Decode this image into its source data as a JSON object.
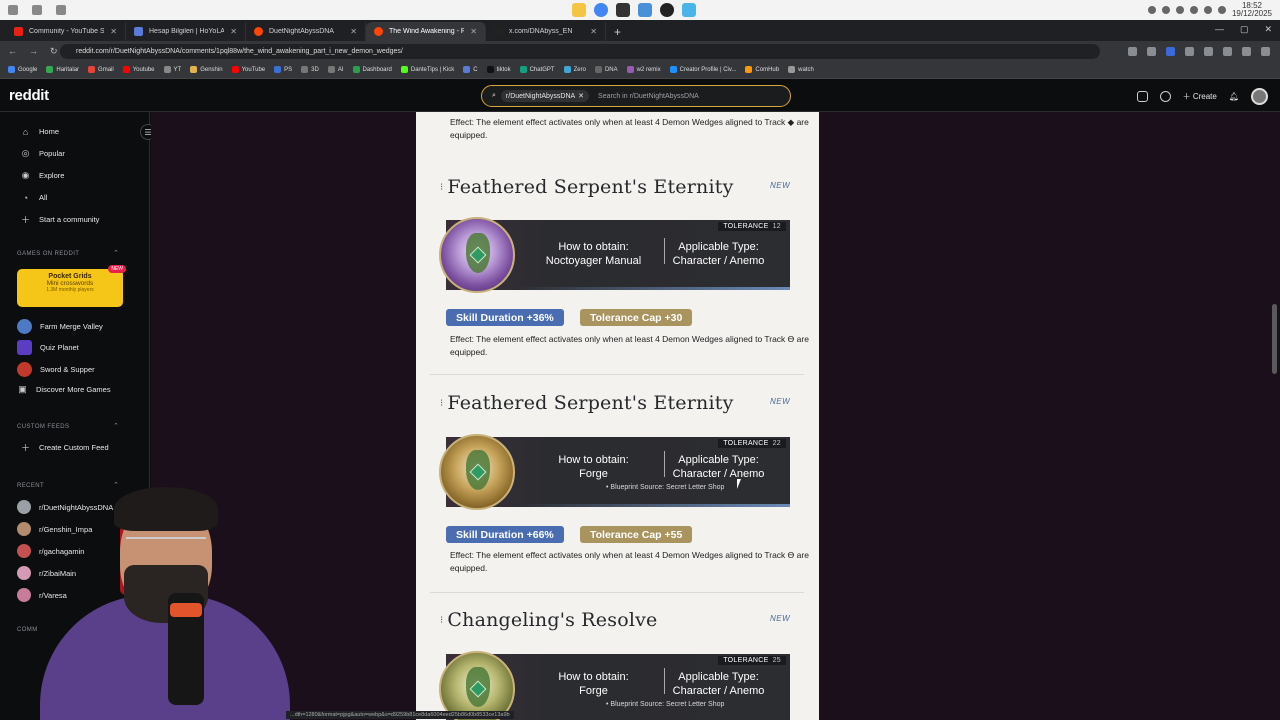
{
  "browser": {
    "tabs": [
      {
        "label": "Community - YouTube Studio",
        "color": "#e62117"
      },
      {
        "label": "Hesap Bilgileri | HoYoLAB",
        "color": "#5a7bd8"
      },
      {
        "label": "DuetNightAbyssDNA",
        "color": "#ff4500"
      },
      {
        "label": "The Wind Awakening - Part I | N",
        "color": "#ff4500"
      },
      {
        "label": "x.com/DNAbyss_EN",
        "color": "#222222"
      }
    ],
    "url": "reddit.com/r/DuetNightAbyssDNA/comments/1pql88w/the_wind_awakening_part_i_new_demon_wedges/",
    "bookmarks": [
      "Google",
      "Haritalar",
      "Gmail",
      "Youtube",
      "YT",
      "Genshin",
      "YouTube",
      "PS",
      "3D",
      "AI",
      "Dashboard",
      "DanteTips | Kick",
      "C",
      "tiktok",
      "ChatGPT",
      "Zero",
      "DNA",
      "w2 remix",
      "Creator Profile | Civ...",
      "ComHub",
      "watch"
    ],
    "clock_time": "18:52",
    "clock_date": "19/12/2025"
  },
  "reddit": {
    "logo": "reddit",
    "search_chip": "r/DuetNightAbyssDNA",
    "search_placeholder": "Search in r/DuetNightAbyssDNA",
    "create_label": "Create"
  },
  "sidebar": {
    "nav": [
      {
        "label": "Home",
        "icon": "home-icon"
      },
      {
        "label": "Popular",
        "icon": "popular-icon"
      },
      {
        "label": "Explore",
        "icon": "explore-icon"
      },
      {
        "label": "All",
        "icon": "all-icon"
      },
      {
        "label": "Start a community",
        "icon": "plus-icon"
      }
    ],
    "games_heading": "GAMES ON REDDIT",
    "promo": {
      "title": "Pocket Grids",
      "subtitle": "Mini crosswords",
      "players": "1.3M monthly players",
      "badge": "NEW"
    },
    "games": [
      "Farm Merge Valley",
      "Quiz Planet",
      "Sword & Supper",
      "Discover More Games"
    ],
    "custom_heading": "CUSTOM FEEDS",
    "create_feed": "Create Custom Feed",
    "recent_heading": "RECENT",
    "recent": [
      "r/DuetNightAbyssDNA",
      "r/Genshin_Impa",
      "r/gachagamin",
      "r/ZibaiMain",
      "r/Varesa"
    ],
    "communities_heading": "COMM"
  },
  "content": {
    "top_effect": "Effect: The element effect activates only when at least 4 Demon Wedges aligned to Track ◆ are equipped.",
    "items": [
      {
        "title": "Feathered Serpent's Eternity",
        "new": "NEW",
        "tolerance_label": "TOLERANCE",
        "tolerance_value": "12",
        "obtain_label": "How to obtain:",
        "obtain_value": "Noctoyager Manual",
        "type_label": "Applicable Type:",
        "type_value": "Character / Anemo",
        "blueprint": "",
        "stat1": "Skill Duration +36%",
        "stat2": "Tolerance Cap +30",
        "effect": "Effect: The element effect activates only when at least 4 Demon Wedges aligned to Track ϴ are equipped."
      },
      {
        "title": "Feathered Serpent's Eternity",
        "new": "NEW",
        "tolerance_label": "TOLERANCE",
        "tolerance_value": "22",
        "obtain_label": "How to obtain:",
        "obtain_value": "Forge",
        "type_label": "Applicable Type:",
        "type_value": "Character / Anemo",
        "blueprint": "• Blueprint Source: Secret Letter Shop",
        "stat1": "Skill Duration +66%",
        "stat2": "Tolerance Cap +55",
        "effect": "Effect: The element effect activates only when at least 4 Demon Wedges aligned to Track ϴ are equipped."
      },
      {
        "title": "Changeling's Resolve",
        "new": "NEW",
        "tolerance_label": "TOLERANCE",
        "tolerance_value": "25",
        "obtain_label": "How to obtain:",
        "obtain_value": "Forge",
        "type_label": "Applicable Type:",
        "type_value": "Character / Anemo",
        "blueprint": "• Blueprint Source: Secret Letter Shop"
      }
    ]
  },
  "status_url": "...dth=1280&format=pjpg&auto=webp&s=d9259b81ce8da6004eed25b86d0b8533ce13a9b"
}
